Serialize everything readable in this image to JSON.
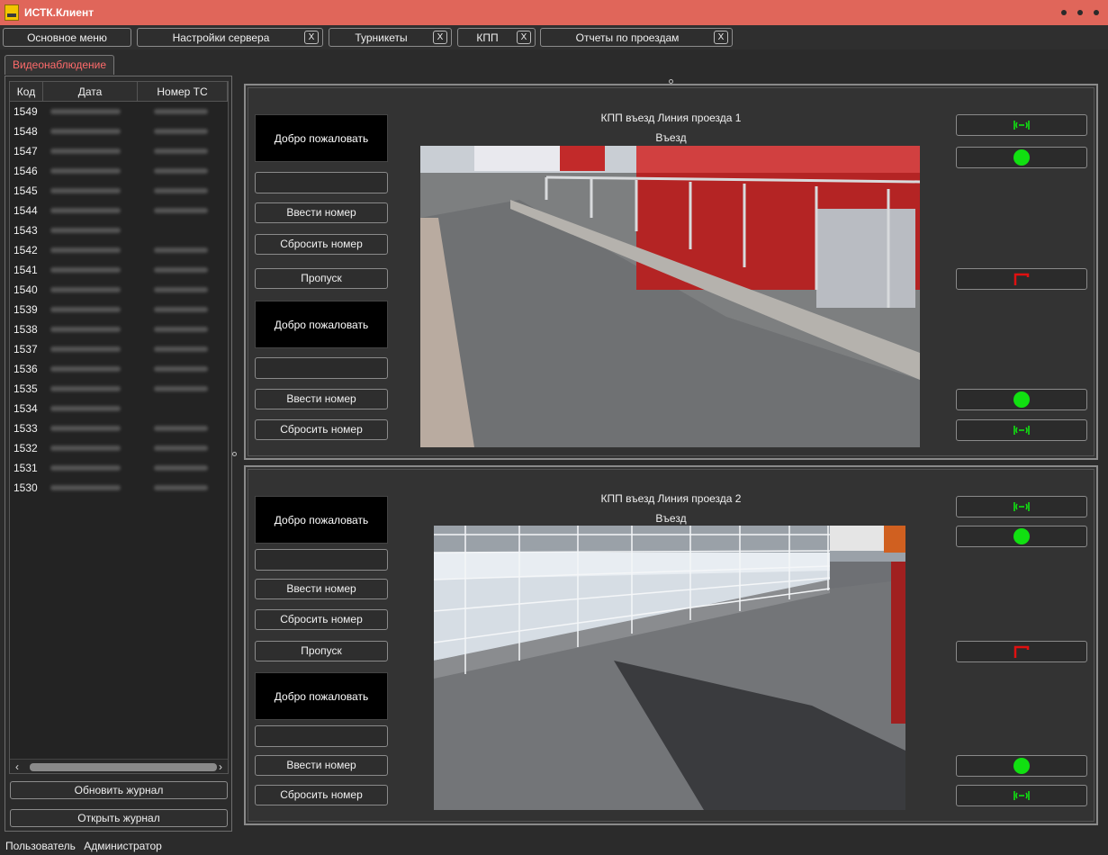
{
  "window": {
    "title": "ИСТК.Клиент"
  },
  "top_tabs": [
    {
      "label": "Основное меню",
      "closable": false
    },
    {
      "label": "Настройки сервера",
      "closable": true
    },
    {
      "label": "Турникеты",
      "closable": true
    },
    {
      "label": "КПП",
      "closable": true
    },
    {
      "label": "Отчеты по проездам",
      "closable": true
    }
  ],
  "close_glyph": "X",
  "sub_tab": "Видеонаблюдение",
  "journal": {
    "columns": [
      "Код",
      "Дата",
      "Номер ТС"
    ],
    "rows": [
      "1549",
      "1548",
      "1547",
      "1546",
      "1545",
      "1544",
      "1543",
      "1542",
      "1541",
      "1540",
      "1539",
      "1538",
      "1537",
      "1536",
      "1535",
      "1534",
      "1533",
      "1532",
      "1531",
      "1530"
    ],
    "refresh_label": "Обновить журнал",
    "open_label": "Открыть журнал"
  },
  "lanes": [
    {
      "title": "КПП въезд Линия проезда 1",
      "direction": "Въезд",
      "welcome_top": "Добро пожаловать",
      "welcome_bottom": "Добро пожаловать",
      "enter_number": "Ввести номер",
      "reset_number": "Сбросить номер",
      "pass": "Пропуск"
    },
    {
      "title": "КПП въезд Линия проезда 2",
      "direction": "Въезд",
      "welcome_top": "Добро пожаловать",
      "welcome_bottom": "Добро пожаловать",
      "enter_number": "Ввести номер",
      "reset_number": "Сбросить номер",
      "pass": "Пропуск"
    }
  ],
  "indicators": {
    "rfid_color": "#11e011",
    "light_color": "#11e011",
    "barrier_color": "#e01010",
    "icons": [
      "rfid-icon",
      "traffic-light-icon",
      "barrier-icon"
    ]
  },
  "status": {
    "user_label": "Пользователь",
    "user_name": "Администратор"
  }
}
